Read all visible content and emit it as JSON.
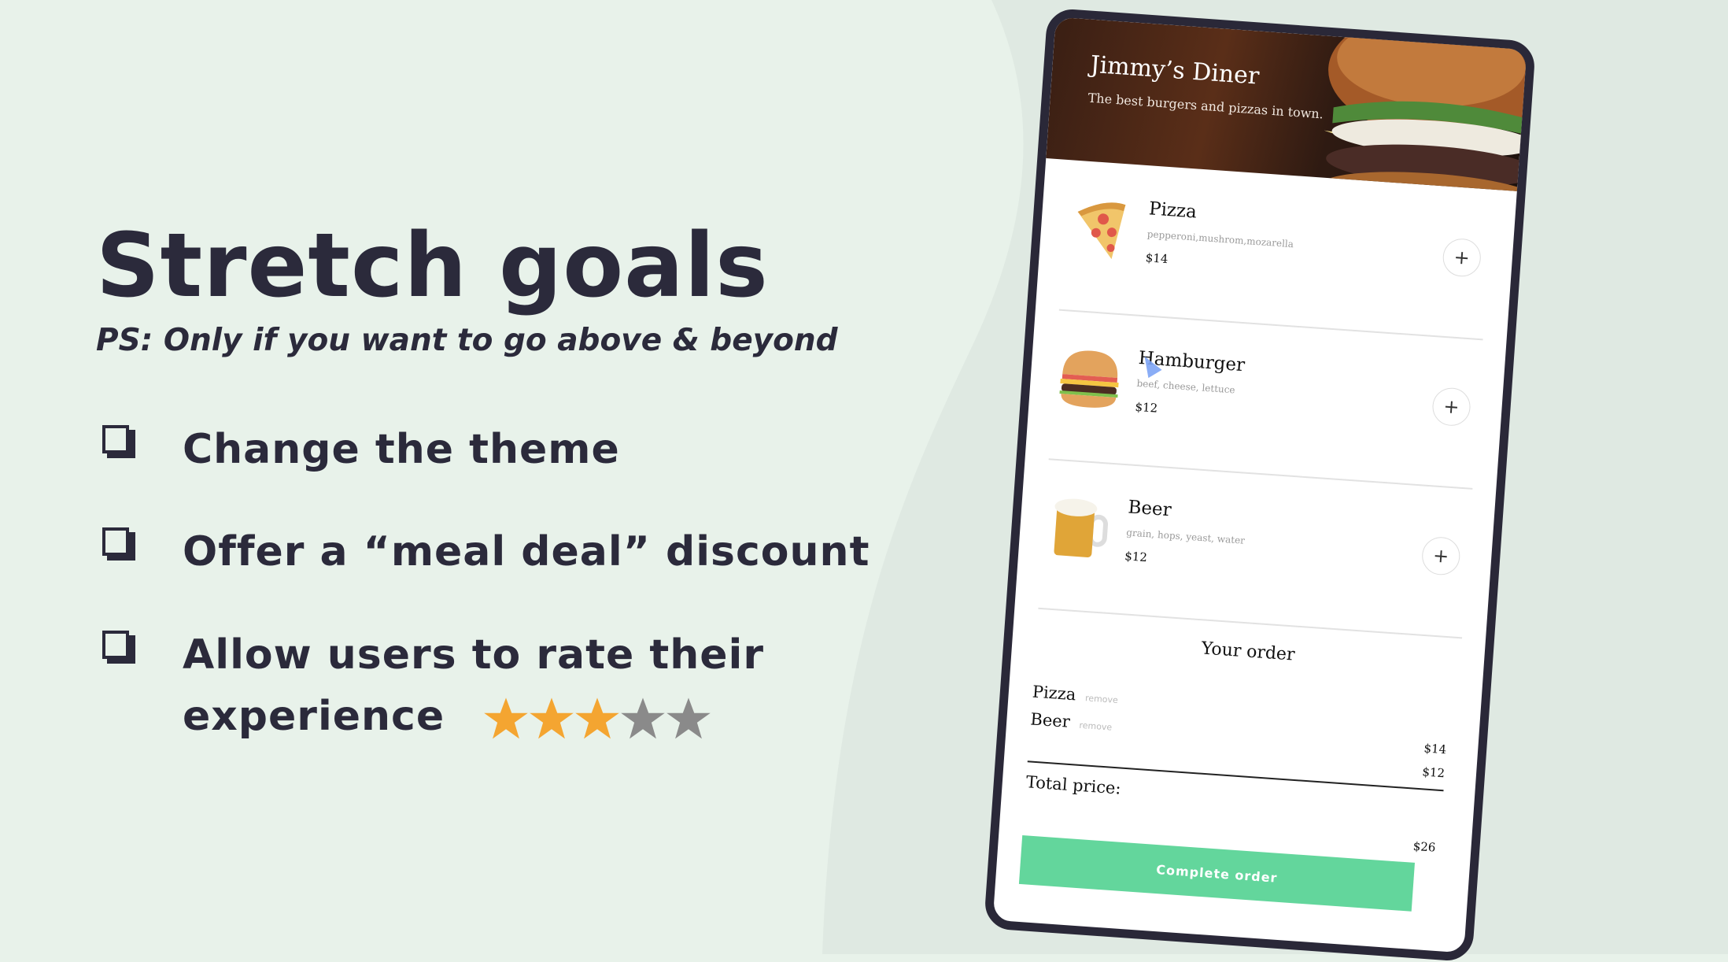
{
  "slide": {
    "title": "Stretch goals",
    "subtitle": "PS: Only if you want to go above & beyond",
    "goals": [
      {
        "text": "Change the theme",
        "icon": "checkbox-icon"
      },
      {
        "text": "Offer a “meal deal” discount",
        "icon": "checkbox-icon"
      },
      {
        "text": "Allow users to rate their",
        "text_line2": "experience",
        "icon": "checkbox-icon"
      }
    ],
    "rating": {
      "value": 3,
      "max": 5,
      "filled_color": "#f4a531",
      "empty_color": "#8a8a8a"
    }
  },
  "colors": {
    "background": "#e8f2ea",
    "text": "#2b2a3b",
    "phone_frame": "#2a2838",
    "accent_green": "#63d69c"
  },
  "app": {
    "header": {
      "title": "Jimmy’s Diner",
      "tagline": "The best burgers and pizzas in town."
    },
    "menu": [
      {
        "name": "Pizza",
        "ingredients": "pepperoni,mushrom,mozarella",
        "price": "$14",
        "icon": "pizza-icon"
      },
      {
        "name": "Hamburger",
        "ingredients": "beef, cheese, lettuce",
        "price": "$12",
        "icon": "hamburger-icon"
      },
      {
        "name": "Beer",
        "ingredients": "grain, hops, yeast, water",
        "price": "$12",
        "icon": "beer-icon"
      }
    ],
    "add_label": "+",
    "order": {
      "title": "Your order",
      "items": [
        {
          "name": "Pizza",
          "remove": "remove",
          "price": "$14"
        },
        {
          "name": "Beer",
          "remove": "remove",
          "price": "$12"
        }
      ],
      "total_label": "Total price:",
      "total": "$26"
    },
    "complete_label": "Complete order"
  }
}
